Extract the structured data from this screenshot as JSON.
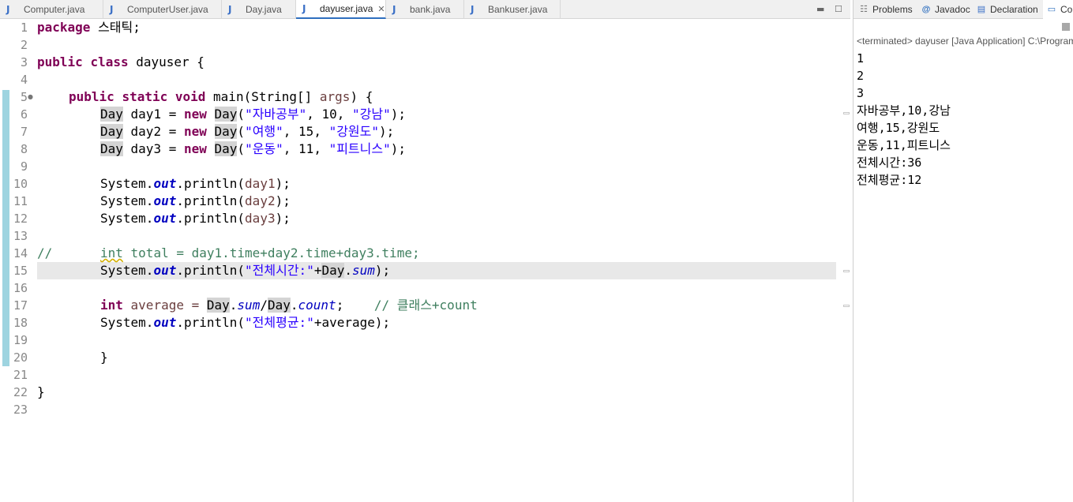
{
  "editor": {
    "tabs": [
      {
        "label": "Computer.java",
        "active": false
      },
      {
        "label": "ComputerUser.java",
        "active": false
      },
      {
        "label": "Day.java",
        "active": false
      },
      {
        "label": "dayuser.java",
        "active": true
      },
      {
        "label": "bank.java",
        "active": false
      },
      {
        "label": "Bankuser.java",
        "active": false
      }
    ],
    "tab_icon": "java-file-icon",
    "line_numbers": [
      "1",
      "2",
      "3",
      "4",
      "5",
      "6",
      "7",
      "8",
      "9",
      "10",
      "11",
      "12",
      "13",
      "14",
      "15",
      "16",
      "17",
      "18",
      "19",
      "20",
      "21",
      "22",
      "23"
    ],
    "code": {
      "l1_kw": "package",
      "l1_rest": " 스태틱;",
      "l3_kw1": "public",
      "l3_kw2": "class",
      "l3_rest": " dayuser {",
      "l5_kw1": "public",
      "l5_kw2": "static",
      "l5_kw3": "void",
      "l5_a": " main(String[] ",
      "l5_var": "args",
      "l5_b": ") {",
      "day": "Day",
      "new": "new",
      "l6_var": " day1 = ",
      "l6_s1": "\"자바공부\"",
      "l6_mid": ", 10, ",
      "l6_s2": "\"강남\"",
      "l6_end": ");",
      "l7_var": " day2 = ",
      "l7_s1": "\"여행\"",
      "l7_mid": ", 15, ",
      "l7_s2": "\"강원도\"",
      "l7_end": ");",
      "l8_var": " day3 = ",
      "l8_s1": "\"운동\"",
      "l8_mid": ", 11, ",
      "l8_s2": "\"피트니스\"",
      "l8_end": ");",
      "system": "System.",
      "out": "out",
      "println": ".println(",
      "day1": "day1",
      "day2": "day2",
      "day3": "day3",
      "close_stmt": ");",
      "l14_slash": "//",
      "l14_int": "int",
      "l14_rest": " total = day1.time+day2.time+day3.time;",
      "l15_str": "\"전체시간:\"",
      "plus": "+",
      "sum": "sum",
      "dot": ".",
      "l17_int": "int",
      "l17_a": " average = ",
      "slash": "/",
      "count": "count",
      "l17_semi": ";",
      "l17_cmt": "// 클래스+count",
      "l18_str": "\"전체평균:\"",
      "l18_rest": "+average);",
      "l20": "}",
      "l22": "}"
    }
  },
  "console": {
    "tabs": [
      {
        "icon": "problems-icon",
        "label": "Problems"
      },
      {
        "icon": "javadoc-icon",
        "label": "Javadoc"
      },
      {
        "icon": "declaration-icon",
        "label": "Declaration"
      },
      {
        "icon": "console-icon",
        "label": "Co"
      }
    ],
    "status": "<terminated> dayuser [Java Application] C:\\Program",
    "output": [
      "1",
      "2",
      "3",
      "자바공부,10,강남",
      "여행,15,강원도",
      "운동,11,피트니스",
      "전체시간:36",
      "전체평균:12"
    ]
  }
}
